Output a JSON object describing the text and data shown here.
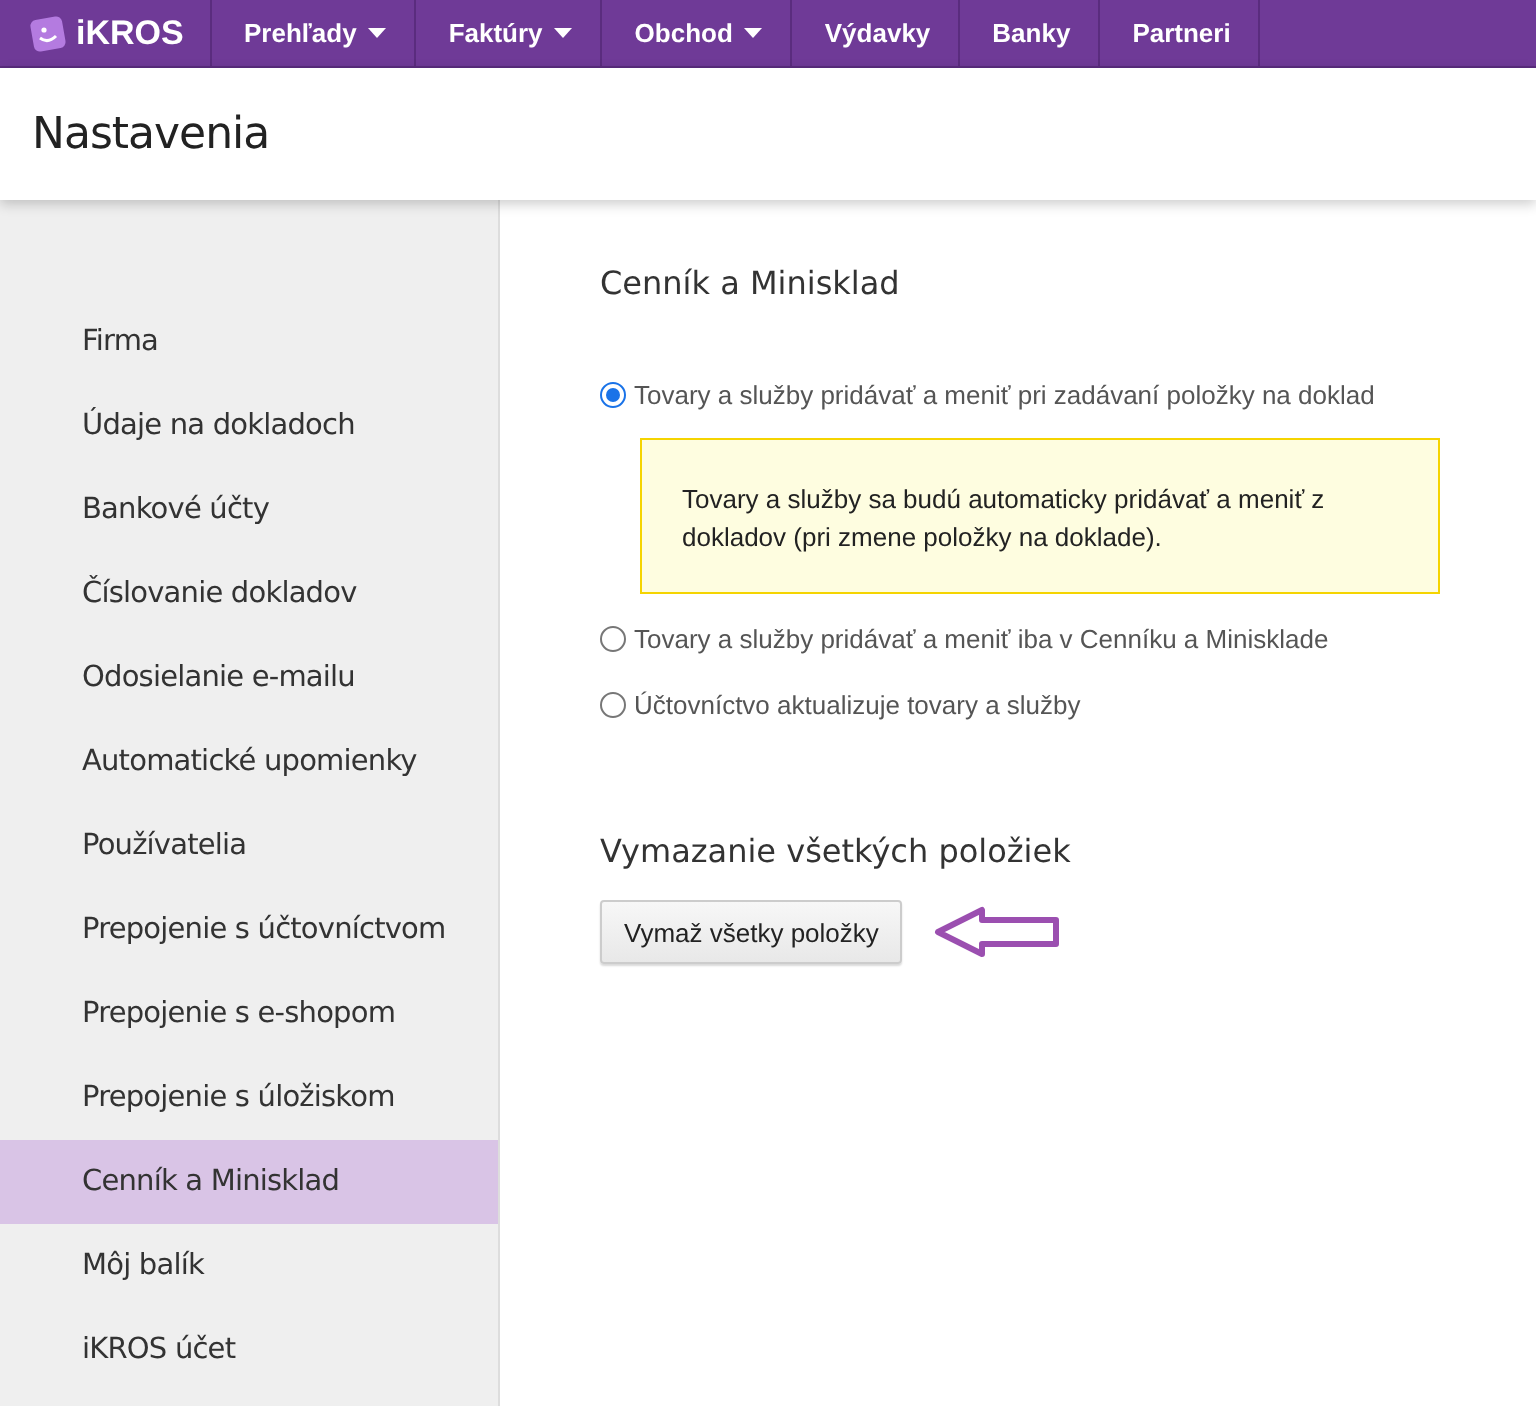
{
  "brand": "iKROS",
  "nav": [
    {
      "label": "Prehľady",
      "dropdown": true
    },
    {
      "label": "Faktúry",
      "dropdown": true
    },
    {
      "label": "Obchod",
      "dropdown": true
    },
    {
      "label": "Výdavky",
      "dropdown": false
    },
    {
      "label": "Banky",
      "dropdown": false
    },
    {
      "label": "Partneri",
      "dropdown": false
    }
  ],
  "page_title": "Nastavenia",
  "sidebar": [
    {
      "label": "Firma",
      "selected": false
    },
    {
      "label": "Údaje na dokladoch",
      "selected": false
    },
    {
      "label": "Bankové účty",
      "selected": false
    },
    {
      "label": "Číslovanie dokladov",
      "selected": false
    },
    {
      "label": "Odosielanie e-mailu",
      "selected": false
    },
    {
      "label": "Automatické upomienky",
      "selected": false
    },
    {
      "label": "Používatelia",
      "selected": false
    },
    {
      "label": "Prepojenie s účtovníctvom",
      "selected": false
    },
    {
      "label": "Prepojenie s e-shopom",
      "selected": false
    },
    {
      "label": "Prepojenie s úložiskom",
      "selected": false
    },
    {
      "label": "Cenník a Minisklad",
      "selected": true
    },
    {
      "label": "Môj balík",
      "selected": false
    },
    {
      "label": "iKROS účet",
      "selected": false
    }
  ],
  "section_title": "Cenník a Minisklad",
  "options": [
    {
      "label": "Tovary a služby pridávať a meniť pri zadávaní položky na doklad",
      "selected": true,
      "note": "Tovary a služby sa budú automaticky pridávať a meniť z dokladov (pri zmene položky na doklade)."
    },
    {
      "label": "Tovary a služby pridávať a meniť iba v Cenníku a Minisklade",
      "selected": false
    },
    {
      "label": "Účtovníctvo aktualizuje tovary a služby",
      "selected": false
    }
  ],
  "delete_section": {
    "title": "Vymazanie všetkých položiek",
    "button": "Vymaž všetky položky"
  }
}
